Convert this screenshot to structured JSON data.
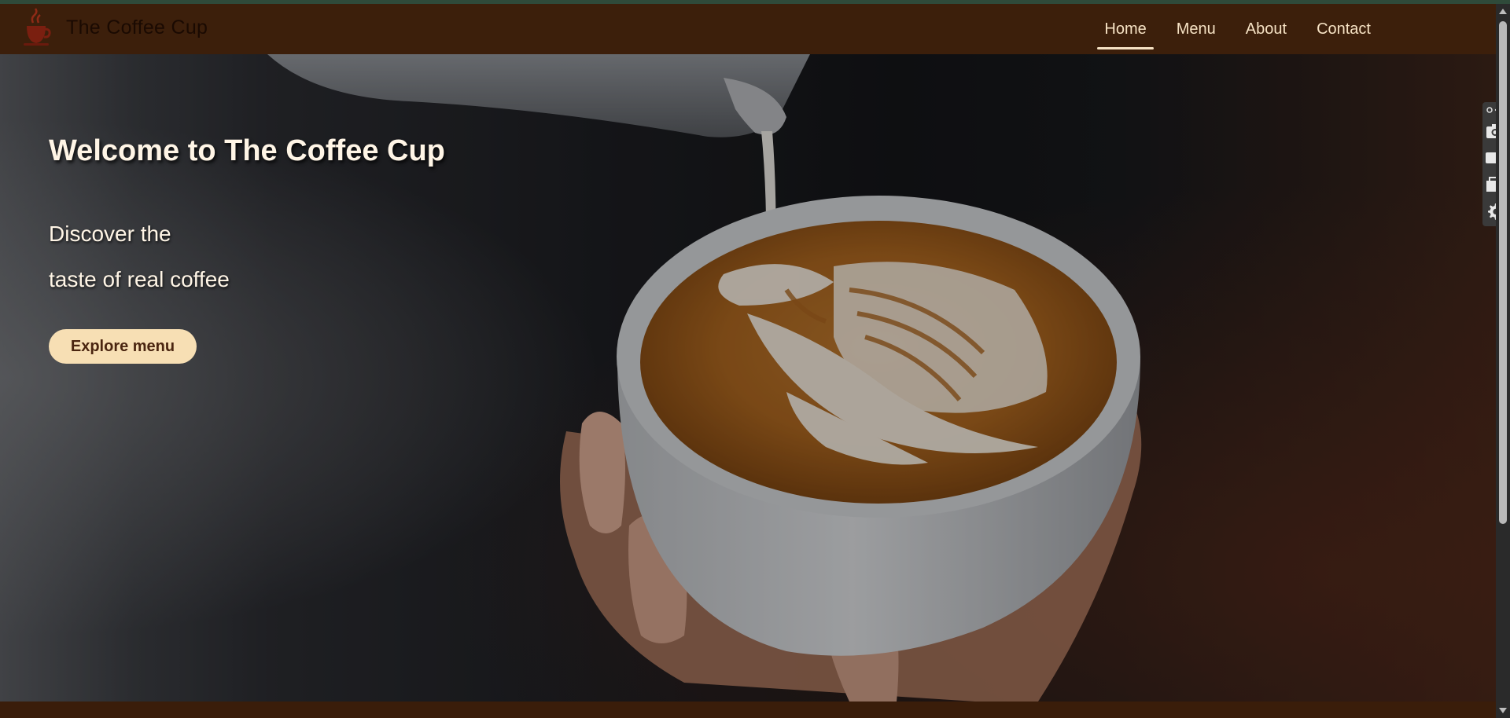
{
  "brand": {
    "name": "The Coffee Cup",
    "logo_icon": "coffee-cup-logo-icon"
  },
  "nav": {
    "items": [
      {
        "label": "Home",
        "active": true
      },
      {
        "label": "Menu",
        "active": false
      },
      {
        "label": "About",
        "active": false
      },
      {
        "label": "Contact",
        "active": false
      }
    ]
  },
  "hero": {
    "title": "Welcome to The Coffee Cup",
    "subtitle_line1": "Discover the",
    "subtitle_line2": "taste of real coffee",
    "cta_label": "Explore menu",
    "image": "latte-art-pour-photo"
  },
  "side_tools": {
    "icons": [
      "extension-icon",
      "camera-icon",
      "video-icon",
      "window-icon",
      "gear-icon"
    ]
  },
  "colors": {
    "navbar_bg": "#3c1f0b",
    "nav_text": "#f6e2c4",
    "cta_bg": "#f7dfb4",
    "cta_text": "#4a2510",
    "hero_text": "#fff5e6"
  }
}
